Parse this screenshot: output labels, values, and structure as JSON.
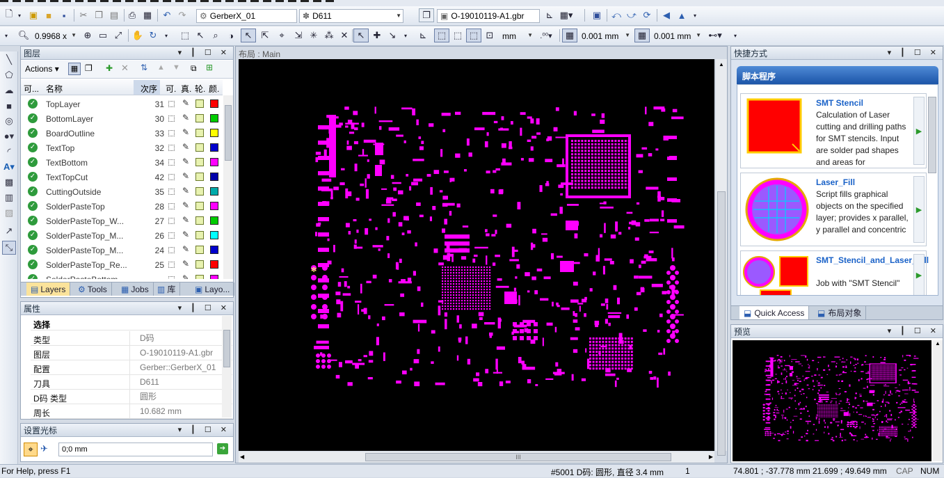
{
  "toolbar1": {
    "combo_config": "GerberX_01",
    "combo_dcode": "D611",
    "combo_file": "O-19010119-A1.gbr"
  },
  "toolbar2": {
    "zoom": "0.9968 x",
    "unit": "mm",
    "grid_x": "0.001 mm",
    "grid_y": "0.001 mm"
  },
  "layers_panel": {
    "title": "图层",
    "actions_label": "Actions",
    "col_visible": "可...",
    "col_name": "名称",
    "col_order": "次序",
    "col_v": "可.",
    "col_t": "真.",
    "col_o": "轮.",
    "col_c": "颜.",
    "rows": [
      {
        "name": "TopLayer",
        "order": "31",
        "color": "#ff0000"
      },
      {
        "name": "BottomLayer",
        "order": "30",
        "color": "#00cc00"
      },
      {
        "name": "BoardOutline",
        "order": "33",
        "color": "#ffff00"
      },
      {
        "name": "TextTop",
        "order": "32",
        "color": "#0000cc"
      },
      {
        "name": "TextBottom",
        "order": "34",
        "color": "#ff00ff"
      },
      {
        "name": "TextTopCut",
        "order": "42",
        "color": "#0000aa"
      },
      {
        "name": "CuttingOutside",
        "order": "35",
        "color": "#00aaaa"
      },
      {
        "name": "SolderPasteTop",
        "order": "28",
        "color": "#ff00ff"
      },
      {
        "name": "SolderPasteTop_W...",
        "order": "27",
        "color": "#00cc00"
      },
      {
        "name": "SolderPasteTop_M...",
        "order": "26",
        "color": "#00ffff"
      },
      {
        "name": "SolderPasteTop_M...",
        "order": "24",
        "color": "#0000cc"
      },
      {
        "name": "SolderPasteTop_Re...",
        "order": "25",
        "color": "#ff0000"
      },
      {
        "name": "SolderPasteBottom",
        "order": "",
        "color": "#ff00ff"
      }
    ],
    "tabs": [
      "Layers",
      "Tools",
      "Jobs",
      "库",
      "Layo..."
    ]
  },
  "props_panel": {
    "title": "属性",
    "section": "选择",
    "rows": [
      {
        "k": "类型",
        "v": "D码"
      },
      {
        "k": "图层",
        "v": "O-19010119-A1.gbr"
      },
      {
        "k": "配置",
        "v": "Gerber::GerberX_01"
      },
      {
        "k": "刀具",
        "v": "D611"
      },
      {
        "k": "D码 类型",
        "v": "圆形"
      },
      {
        "k": "周长",
        "v": "10.682 mm"
      }
    ]
  },
  "cursor_panel": {
    "title": "设置光标",
    "value": "0;0 mm"
  },
  "main": {
    "title": "布局 : Main",
    "scroll_grip": "III"
  },
  "shortcuts": {
    "title": "快捷方式",
    "group": "脚本程序",
    "cards": [
      {
        "title": "SMT Stencil",
        "desc": "Calculation of Laser cutting and drilling paths for SMT stencils. Input are solder pad shapes and areas for"
      },
      {
        "title": "Laser_Fill",
        "desc": "Script fills graphical objects on the specified layer; provides x parallel, y parallel and concentric"
      },
      {
        "title": "SMT_Stencil_and_Laser_Fill",
        "desc": "Job with \"SMT Stencil\" and \"Laser_Fill\""
      }
    ],
    "tabs": [
      "Quick Access",
      "布局对象"
    ]
  },
  "preview": {
    "title": "预览"
  },
  "status": {
    "help": "For Help, press F1",
    "info": "#5001 D码: 圆形, 直径 3.4 mm",
    "count": "1",
    "coord1": "74.801 ; -37.778 mm",
    "coord2": "21.699 ; 49.649 mm",
    "cap": "CAP",
    "num": "NUM"
  }
}
